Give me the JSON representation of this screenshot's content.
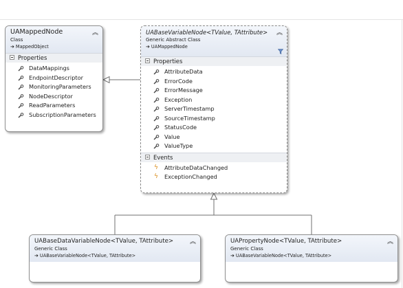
{
  "classes": {
    "ua_mapped_node": {
      "name": "UAMappedNode",
      "kind": "Class",
      "base": "MappedObject",
      "sections": [
        {
          "title": "Properties",
          "items": [
            "DataMappings",
            "EndpointDescriptor",
            "MonitoringParameters",
            "NodeDescriptor",
            "ReadParameters",
            "SubscriptionParameters"
          ]
        }
      ]
    },
    "ua_base_variable_node": {
      "name": "UABaseVariableNode<TValue, TAttribute>",
      "kind": "Generic Abstract Class",
      "base": "UAMappedNode",
      "sections": [
        {
          "title": "Properties",
          "items": [
            "AttributeData",
            "ErrorCode",
            "ErrorMessage",
            "Exception",
            "ServerTimestamp",
            "SourceTimestamp",
            "StatusCode",
            "Value",
            "ValueType"
          ]
        },
        {
          "title": "Events",
          "items": [
            "AttributeDataChanged",
            "ExceptionChanged"
          ]
        }
      ]
    },
    "ua_base_data_variable_node": {
      "name": "UABaseDataVariableNode<TValue, TAttribute>",
      "kind": "Generic Class",
      "base": "UABaseVariableNode<TValue, TAttribute>"
    },
    "ua_property_node": {
      "name": "UAPropertyNode<TValue, TAttribute>",
      "kind": "Generic Class",
      "base": "UABaseVariableNode<TValue, TAttribute>"
    }
  },
  "colors": {
    "border": "#8f8f8f",
    "header": "#e2e8f2",
    "event_icon": "#d98c1a"
  }
}
